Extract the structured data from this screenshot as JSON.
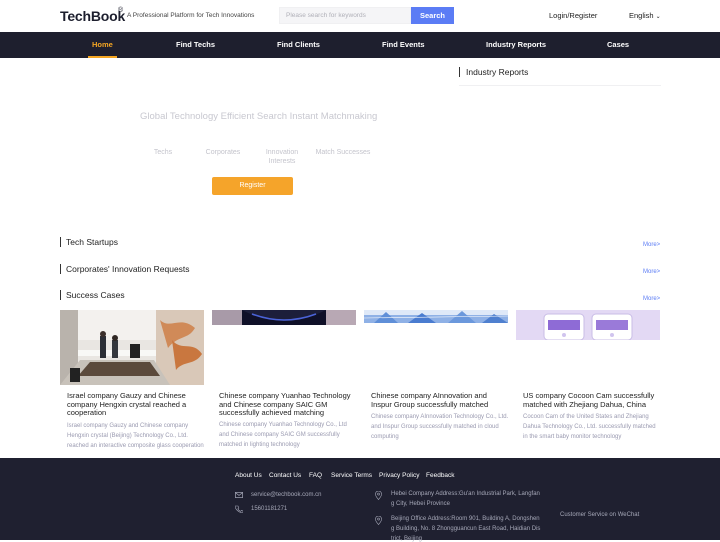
{
  "header": {
    "logo": "TechBook",
    "logo_mark": "®",
    "slogan": "A Professional Platform for Tech Innovations",
    "search_placeholder": "Please search for keywords",
    "search_button": "Search",
    "login": "Login/Register",
    "language": "English"
  },
  "nav": {
    "items": [
      {
        "label": "Home",
        "active": true
      },
      {
        "label": "Find Techs"
      },
      {
        "label": "Find Clients"
      },
      {
        "label": "Find Events"
      },
      {
        "label": "Industry Reports"
      },
      {
        "label": "Cases"
      }
    ]
  },
  "hero": {
    "title": "Global Technology Efficient Search Instant Matchmaking",
    "stats": [
      {
        "label": "Techs"
      },
      {
        "label": "Corporates"
      },
      {
        "label": "Innovation Interests"
      },
      {
        "label": "Match Successes"
      }
    ],
    "register_button": "Register"
  },
  "sidebar": {
    "heading": "Industry Reports"
  },
  "sections": [
    {
      "heading": "Tech Startups",
      "more": "More>"
    },
    {
      "heading": "Corporates' Innovation Requests",
      "more": "More>"
    },
    {
      "heading": "Success Cases",
      "more": "More>"
    }
  ],
  "cases": [
    {
      "title": "Israel company Gauzy and Chinese company Hengxin crystal reached a cooperation",
      "desc": "Israel company Gauzy and Chinese company Hengxin crystal (Beijing) Technology Co., Ltd. reached an interactive composite glass cooperation"
    },
    {
      "title": "Chinese company Yuanhao Technology and Chinese company SAIC GM successfully achieved matching",
      "desc": "Chinese company Yuanhao Technology Co., Ltd and Chinese company SAIC GM successfully matched in lighting technology"
    },
    {
      "title": "Chinese company AInnovation and Inspur Group successfully matched",
      "desc": "Chinese company AInnovation Technology Co., Ltd. and Inspur Group successfully matched in cloud computing"
    },
    {
      "title": "US company Cocoon Cam successfully matched with Zhejiang Dahua, China",
      "desc": "Cocoon Cam of the United States and Zhejiang Dahua Technology Co., Ltd. successfully matched in the smart baby monitor technology"
    }
  ],
  "footer": {
    "links": [
      "About Us",
      "Contact Us",
      "FAQ",
      "Service Terms",
      "Privacy Policy",
      "Feedback"
    ],
    "email": "service@techbook.com.cn",
    "phone": "15601181271",
    "address1_l1": "Hebei Company Address:Gu'an Industrial Park, Langfan",
    "address1_l2": "g City, Hebei Province",
    "address2_l1": "Beijing Office Address:Room 901, Building A, Dongshen",
    "address2_l2": "g Building, No. 8 Zhongguancun East Road, Haidian Dis",
    "address2_l3": "trict, Beijing",
    "wechat": "Customer Service on WeChat"
  },
  "colors": {
    "accent": "#f5a623",
    "brand_blue": "#5b7cf5",
    "nav_bg": "#1e1f2e",
    "footer_bg": "#1f2030"
  }
}
